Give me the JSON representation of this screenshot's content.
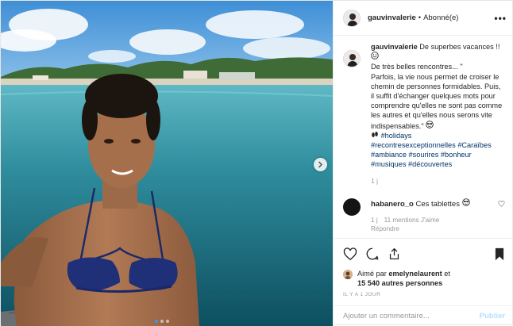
{
  "header": {
    "username": "gauvinvalerie",
    "separator": "•",
    "follow_status": "Abonné(e)",
    "more": "•••"
  },
  "caption": {
    "username": "gauvinvalerie",
    "line1": "De superbes vacances !!",
    "line2": "De très belles rencontres... \"",
    "body": "Parfois, la vie nous permet de croiser le chemin de personnes formidables. Puis, il suffit d'échanger quelques mots pour comprendre qu'elles ne sont pas comme les autres et qu'elles nous serons vite indispensables.\"",
    "hashtags": [
      "#holidays",
      "#recontresexceptionnelles",
      "#Caraïbes",
      "#ambiance",
      "#sourires",
      "#bonheur",
      "#musiques",
      "#découvertes"
    ],
    "time": "1 j"
  },
  "reply": {
    "username": "habanero_o",
    "text": "Ces tablettes",
    "time": "1 j",
    "likes": "11 mentions J'aime",
    "reply_label": "Répondre"
  },
  "likes": {
    "prefix": "Aimé par",
    "user": "emelynelaurent",
    "connector": "et",
    "count": "15 540 autres personnes"
  },
  "date": "IL Y A 1 JOUR",
  "comment_box": {
    "placeholder": "Ajouter un commentaire...",
    "publish_label": "Publier"
  },
  "carousel": {
    "count": 3,
    "active": 0
  },
  "colors": {
    "link": "#003569",
    "accent": "#3897f0",
    "publish": "#b2dffc",
    "muted": "#999999"
  },
  "icons": [
    "heart-icon",
    "comment-icon",
    "share-icon",
    "bookmark-icon",
    "chevron-right-icon",
    "smiley-icon",
    "sunglasses-icon",
    "footprint-icon",
    "ellipsis-icon"
  ]
}
